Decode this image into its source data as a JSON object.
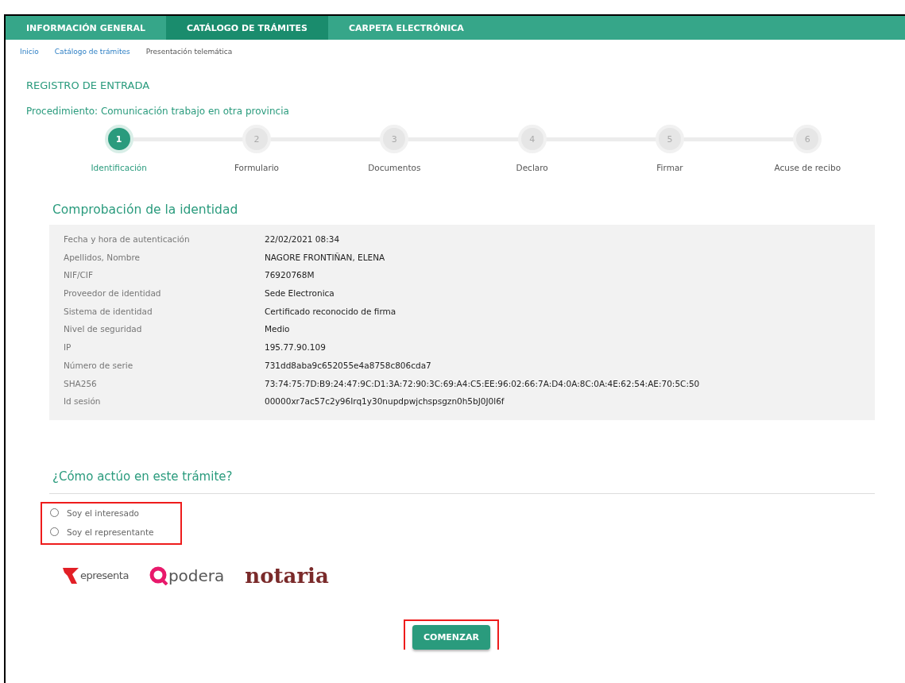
{
  "nav": {
    "tabs": [
      {
        "label": "INFORMACIÓN GENERAL",
        "selected": false
      },
      {
        "label": "CATÁLOGO DE TRÁMITES",
        "selected": true
      },
      {
        "label": "CARPETA ELECTRÓNICA",
        "selected": false
      }
    ]
  },
  "breadcrumb": [
    {
      "label": "Inicio",
      "kind": "link"
    },
    {
      "label": "Catálogo de trámites",
      "kind": "link"
    },
    {
      "label": "Presentación telemática",
      "kind": "current"
    }
  ],
  "title": "REGISTRO DE ENTRADA",
  "procedure": "Procedimiento: Comunicación trabajo en otra provincia",
  "steps": [
    {
      "number": "1",
      "label": "Identificación",
      "selected": true
    },
    {
      "number": "2",
      "label": "Formulario",
      "selected": false
    },
    {
      "number": "3",
      "label": "Documentos",
      "selected": false
    },
    {
      "number": "4",
      "label": "Declaro",
      "selected": false
    },
    {
      "number": "5",
      "label": "Firmar",
      "selected": false
    },
    {
      "number": "6",
      "label": "Acuse de recibo",
      "selected": false
    }
  ],
  "identity": {
    "heading": "Comprobación de la identidad",
    "rows": [
      {
        "label": "Fecha y hora de autenticación",
        "value": "22/02/2021 08:34"
      },
      {
        "label": "Apellidos, Nombre",
        "value": "NAGORE FRONTIÑAN, ELENA"
      },
      {
        "label": "NIF/CIF",
        "value": "76920768M"
      },
      {
        "label": "Proveedor de identidad",
        "value": "Sede Electronica"
      },
      {
        "label": "Sistema de identidad",
        "value": "Certificado reconocido de firma"
      },
      {
        "label": "Nivel de seguridad",
        "value": "Medio"
      },
      {
        "label": "IP",
        "value": "195.77.90.109"
      },
      {
        "label": "Número de serie",
        "value": "731dd8aba9c652055e4a8758c806cda7"
      },
      {
        "label": "SHA256",
        "value": "73:74:75:7D:B9:24:47:9C:D1:3A:72:90:3C:69:A4:C5:EE:96:02:66:7A:D4:0A:8C:0A:4E:62:54:AE:70:5C:50"
      },
      {
        "label": "Id sesión",
        "value": "00000xr7ac57c2y96Irq1y30nupdpwjchspsgzn0h5bJ0J0l6f"
      }
    ]
  },
  "role": {
    "heading": "¿Cómo actúo en este trámite?",
    "highlighted": true,
    "options": [
      {
        "label": "Soy el interesado",
        "selected": false
      },
      {
        "label": "Soy el representante",
        "selected": false
      }
    ]
  },
  "logos": [
    {
      "kind": "represent",
      "text": "epresenta"
    },
    {
      "kind": "apodera",
      "text": "podera"
    },
    {
      "kind": "notaria",
      "text": "notaria"
    }
  ],
  "start_button": {
    "label": "COMENZAR",
    "highlighted": true
  }
}
